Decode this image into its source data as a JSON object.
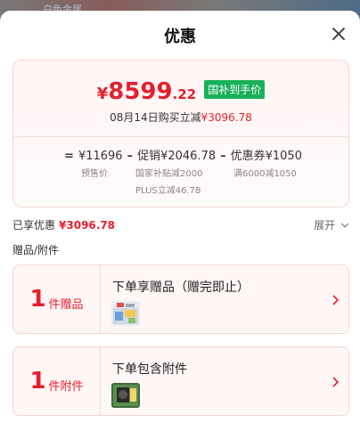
{
  "backdrop": {
    "text": "白色金属"
  },
  "sheet": {
    "title": "优惠"
  },
  "price": {
    "yen": "¥",
    "integer": "8599",
    "decimal": ".22",
    "tag": "国补到手价",
    "buy_prefix": "08月14日购买立减",
    "buy_amount": "¥3096.78"
  },
  "formula": {
    "eq": "=",
    "base": "¥11696",
    "minus1": "–",
    "promo": "促销¥2046.78",
    "minus2": "–",
    "coupon": "优惠券¥1050",
    "base_note": "预售价",
    "promo_note1": "国家补贴减2000",
    "promo_note2": "PLUS立减46.78",
    "coupon_note": "满6000减1050"
  },
  "enjoy": {
    "label": "已享优惠",
    "amount": "¥3096.78",
    "expand": "展开"
  },
  "section": {
    "label": "赠品/附件"
  },
  "gifts": [
    {
      "num": "1",
      "unit": "件赠品",
      "title": "下单享赠品（赠完即止）"
    },
    {
      "num": "1",
      "unit": "件附件",
      "title": "下单包含附件"
    }
  ],
  "colors": {
    "accent": "#e4202e",
    "tag_green": "#18b05a"
  }
}
